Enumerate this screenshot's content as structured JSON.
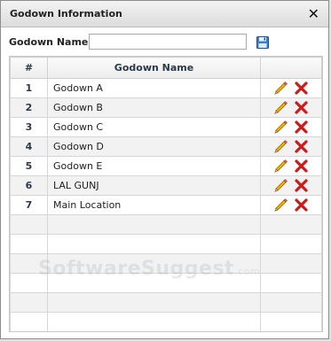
{
  "dialog": {
    "title": "Godown Information",
    "close_icon": "close-icon"
  },
  "form": {
    "label": "Godown Name",
    "value": "",
    "placeholder": "",
    "save_icon": "floppy-save-icon"
  },
  "table": {
    "columns": [
      "#",
      "Godown Name",
      ""
    ],
    "rows": [
      {
        "num": "1",
        "name": "Godown A"
      },
      {
        "num": "2",
        "name": "Godown B"
      },
      {
        "num": "3",
        "name": "Godown C"
      },
      {
        "num": "4",
        "name": "Godown D"
      },
      {
        "num": "5",
        "name": "Godown E"
      },
      {
        "num": "6",
        "name": "LAL GUNJ"
      },
      {
        "num": "7",
        "name": "Main Location"
      }
    ],
    "row_actions": [
      "edit-pencil-icon",
      "delete-x-icon"
    ],
    "empty_rows": 6
  },
  "watermark": {
    "text": "SoftwareSuggest",
    "suffix": ".com"
  },
  "colors": {
    "delete": "#cc1b1b",
    "pencil": "#f2b100",
    "header_bg": "#eeeeee"
  }
}
